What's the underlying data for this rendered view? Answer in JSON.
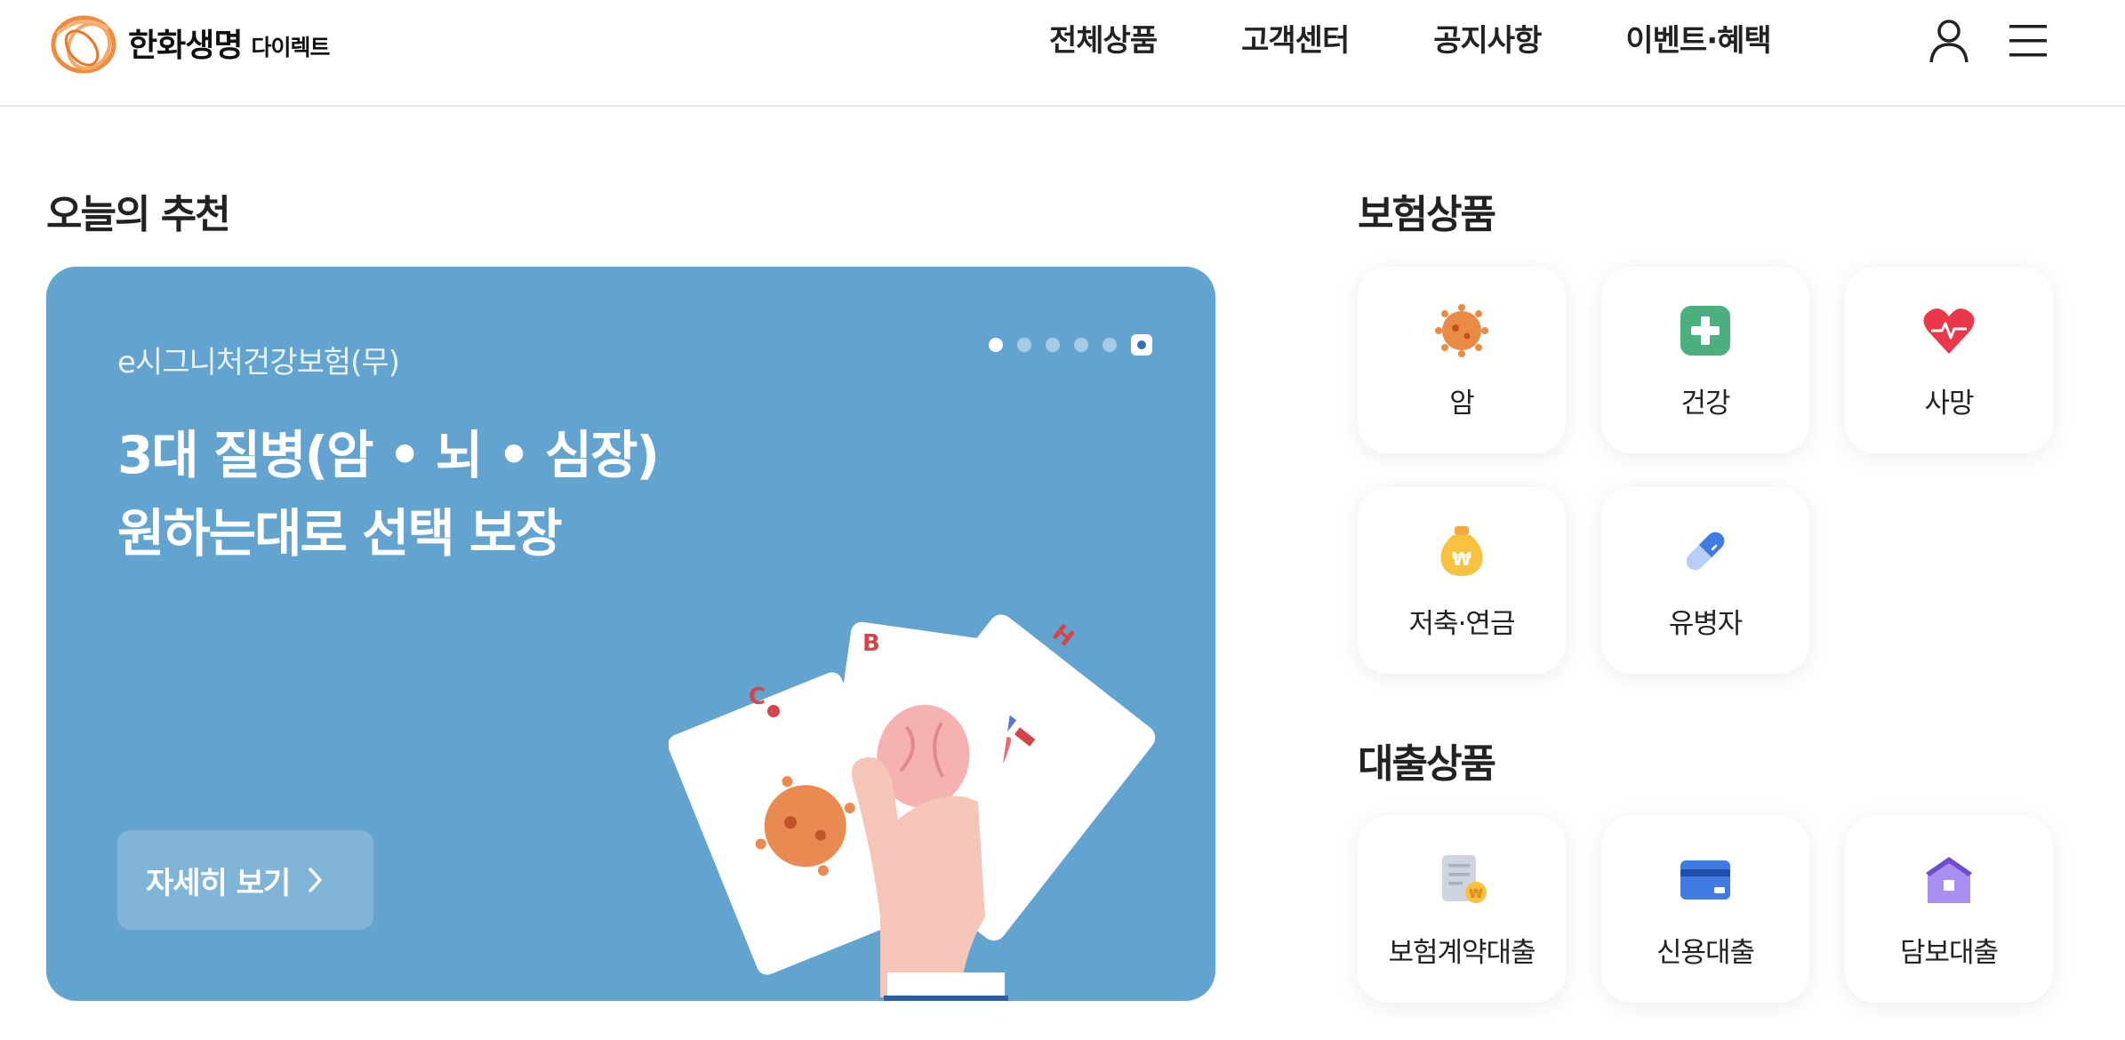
{
  "header": {
    "logo_name": "한화생명",
    "logo_sub": "다이렉트",
    "nav": [
      "전체상품",
      "고객센터",
      "공지사항",
      "이벤트·혜택"
    ],
    "user_icon": "user-icon",
    "menu_icon": "hamburger-menu-icon"
  },
  "recommendation": {
    "title": "오늘의 추천",
    "product_name": "e시그니처건강보험(무)",
    "headline_line1": "3대 질병(암 • 뇌 • 심장)",
    "headline_line2": "원하는대로 선택 보장",
    "detail_button": "자세히 보기",
    "slides_count": 5,
    "active_slide": 1,
    "background_color": "#62a3cf"
  },
  "insurance": {
    "title": "보험상품",
    "items": [
      {
        "label": "암",
        "icon": "virus-icon"
      },
      {
        "label": "건강",
        "icon": "health-cross-icon"
      },
      {
        "label": "사망",
        "icon": "heart-pulse-icon"
      },
      {
        "label": "저축·연금",
        "icon": "money-bag-icon"
      },
      {
        "label": "유병자",
        "icon": "pill-icon"
      }
    ]
  },
  "loans": {
    "title": "대출상품",
    "items": [
      {
        "label": "보험계약대출",
        "icon": "document-coin-icon"
      },
      {
        "label": "신용대출",
        "icon": "credit-card-icon"
      },
      {
        "label": "담보대출",
        "icon": "house-icon"
      }
    ]
  }
}
